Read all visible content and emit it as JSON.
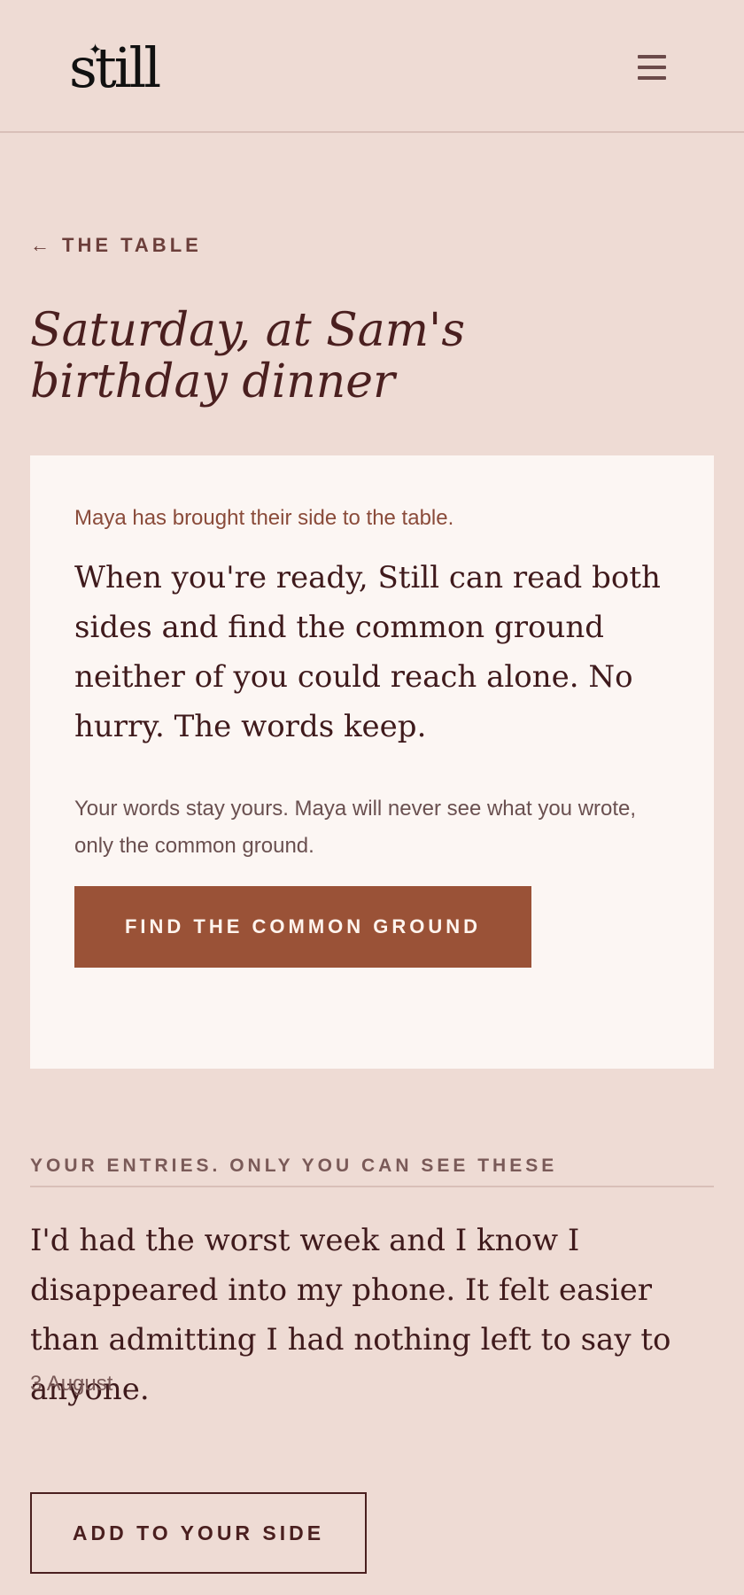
{
  "header": {
    "logo_text": "still",
    "menu_icon": "hamburger-menu-icon"
  },
  "nav": {
    "back_arrow": "←",
    "back_label": "THE TABLE"
  },
  "page": {
    "title": "Saturday, at Sam's birthday dinner"
  },
  "card": {
    "intro": "Maya has brought their side to the table.",
    "body": "When you're ready, Still can read both sides and find the common ground neither of you could reach alone. No hurry. The words keep.",
    "note": "Your words stay yours. Maya will never see what you wrote, only the common ground.",
    "button_label": "FIND THE COMMON GROUND"
  },
  "entries": {
    "heading": "YOUR ENTRIES. ONLY YOU CAN SEE THESE",
    "items": [
      {
        "text": "I'd had the worst week and I know I disappeared into my phone. It felt easier than admitting I had nothing left to say to anyone.",
        "date": "3 August"
      }
    ]
  },
  "actions": {
    "add_label": "ADD TO YOUR SIDE"
  },
  "colors": {
    "background": "#EEDBD4",
    "card": "#FCF6F3",
    "accent": "#9A5237",
    "text_dark": "#4A1F1F"
  }
}
